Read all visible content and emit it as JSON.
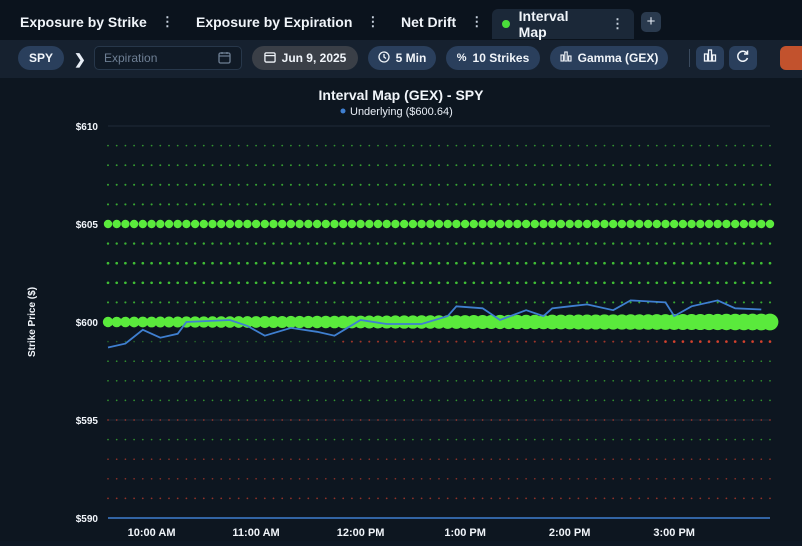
{
  "tabs": [
    {
      "label": "Exposure by Strike",
      "active": false
    },
    {
      "label": "Exposure by Expiration",
      "active": false
    },
    {
      "label": "Net Drift",
      "active": false
    },
    {
      "label": "Interval Map",
      "active": true
    }
  ],
  "tab_menu_glyph": "⋮",
  "add_tab_glyph": "+",
  "toolbar": {
    "symbol": "SPY",
    "expiration_placeholder": "Expiration",
    "date": "Jun 9, 2025",
    "interval": "5 Min",
    "strikes": "10 Strikes",
    "greek": "Gamma (GEX)"
  },
  "icons": {
    "calendar": "calendar-icon",
    "clock": "clock-icon",
    "percent": "percent-icon",
    "bar": "bar-chart-icon",
    "refresh": "refresh-icon"
  },
  "colors": {
    "accent": "#4ade3a",
    "negative": "#e0432e",
    "underlying": "#3f7fd0",
    "background": "#0d1620"
  },
  "chart_data": {
    "type": "scatter",
    "title": "Interval Map (GEX) - SPY",
    "legend": "Underlying ($600.64)",
    "ylabel": "Strike Price ($)",
    "ylim": [
      590,
      610
    ],
    "yticks": [
      "$610",
      "$605",
      "$600",
      "$595",
      "$590"
    ],
    "xticks": [
      "10:00 AM",
      "11:00 AM",
      "12:00 PM",
      "1:00 PM",
      "2:00 PM",
      "3:00 PM"
    ],
    "x_start": "9:35 AM",
    "x_end": "3:55 PM",
    "interval_minutes": 5,
    "strikes": [
      609,
      608,
      607,
      606,
      605,
      604,
      603,
      602,
      601,
      600,
      599,
      598,
      597,
      596,
      595,
      594,
      593,
      592,
      591
    ],
    "strike_intensity": {
      "609": 0.05,
      "608": 0.08,
      "607": 0.1,
      "606": 0.12,
      "605": 1.0,
      "604": 0.15,
      "603": 0.2,
      "602": 0.2,
      "601": 0.12,
      "600": 1.0,
      "599": -0.1,
      "598": 0.05,
      "597": 0.05,
      "596": 0.05,
      "595": -0.05,
      "594": 0.04,
      "593": -0.04,
      "592": -0.04,
      "591": -0.06
    },
    "underlying_anchors": [
      {
        "t": "9:35 AM",
        "price": 598.7
      },
      {
        "t": "9:45 AM",
        "price": 598.9
      },
      {
        "t": "9:55 AM",
        "price": 599.6
      },
      {
        "t": "10:05 AM",
        "price": 599.2
      },
      {
        "t": "10:15 AM",
        "price": 599.4
      },
      {
        "t": "10:20 AM",
        "price": 600.0
      },
      {
        "t": "10:45 AM",
        "price": 600.1
      },
      {
        "t": "10:55 AM",
        "price": 599.8
      },
      {
        "t": "11:05 AM",
        "price": 599.3
      },
      {
        "t": "11:20 AM",
        "price": 599.7
      },
      {
        "t": "11:35 AM",
        "price": 599.5
      },
      {
        "t": "11:45 AM",
        "price": 599.3
      },
      {
        "t": "12:00 PM",
        "price": 600.1
      },
      {
        "t": "12:15 PM",
        "price": 599.9
      },
      {
        "t": "12:35 PM",
        "price": 599.9
      },
      {
        "t": "12:50 PM",
        "price": 600.3
      },
      {
        "t": "12:55 PM",
        "price": 600.8
      },
      {
        "t": "1:10 PM",
        "price": 600.7
      },
      {
        "t": "1:20 PM",
        "price": 600.1
      },
      {
        "t": "1:35 PM",
        "price": 600.6
      },
      {
        "t": "1:45 PM",
        "price": 600.3
      },
      {
        "t": "1:50 PM",
        "price": 600.7
      },
      {
        "t": "2:00 PM",
        "price": 600.8
      },
      {
        "t": "2:10 PM",
        "price": 600.9
      },
      {
        "t": "2:25 PM",
        "price": 600.6
      },
      {
        "t": "2:35 PM",
        "price": 601.1
      },
      {
        "t": "2:55 PM",
        "price": 601.0
      },
      {
        "t": "3:00 PM",
        "price": 600.3
      },
      {
        "t": "3:10 PM",
        "price": 600.8
      },
      {
        "t": "3:25 PM",
        "price": 601.1
      },
      {
        "t": "3:35 PM",
        "price": 600.7
      },
      {
        "t": "3:50 PM",
        "price": 600.64
      }
    ]
  }
}
